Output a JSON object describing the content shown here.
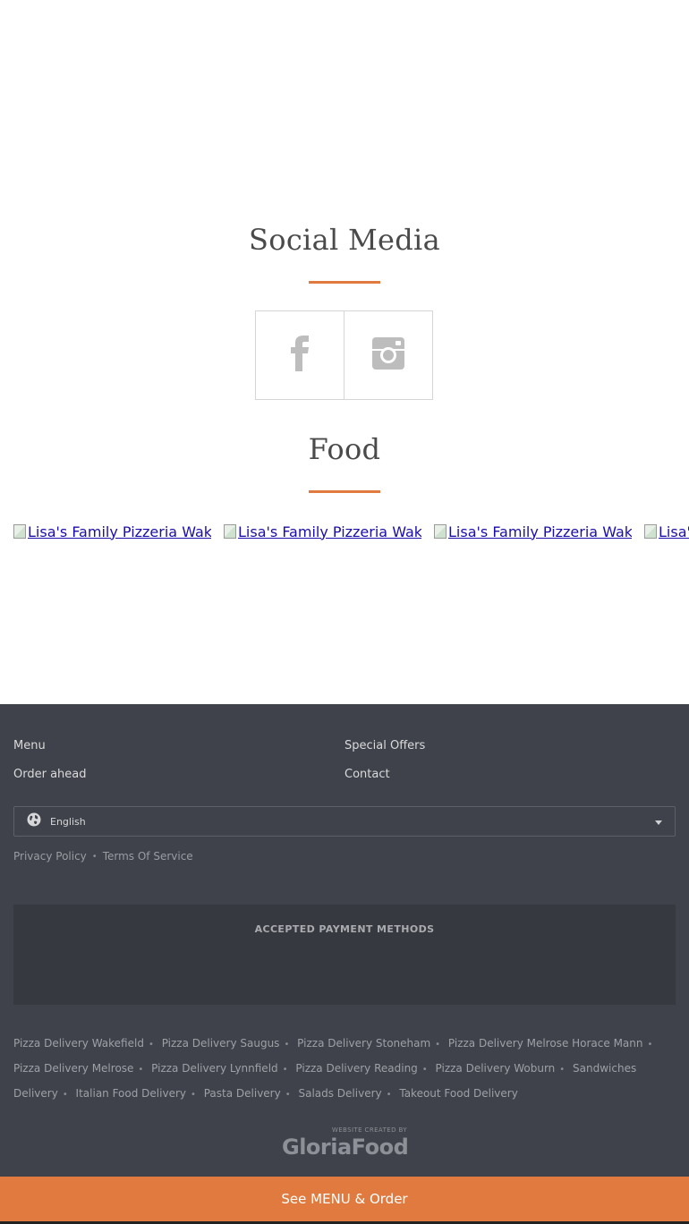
{
  "social": {
    "title": "Social Media",
    "links": [
      {
        "icon": "facebook-icon"
      },
      {
        "icon": "instagram-icon"
      }
    ]
  },
  "food": {
    "title": "Food",
    "images": [
      {
        "alt": "Lisa's Family Pizzeria Wakefield"
      },
      {
        "alt": "Lisa's Family Pizzeria Wakefield"
      },
      {
        "alt": "Lisa's Family Pizzeria Wakefield"
      },
      {
        "alt": "Lisa's Family Pizzeria Wakefield"
      }
    ]
  },
  "footer": {
    "nav": {
      "menu": "Menu",
      "special_offers": "Special Offers",
      "order_ahead": "Order ahead",
      "contact": "Contact"
    },
    "language": {
      "selected": "English"
    },
    "legal": {
      "privacy": "Privacy Policy",
      "terms": "Terms Of Service"
    },
    "payment_title": "ACCEPTED PAYMENT METHODS",
    "seo_links": [
      "Pizza Delivery Wakefield",
      "Pizza Delivery Saugus",
      "Pizza Delivery Stoneham",
      "Pizza Delivery Melrose Horace Mann",
      "Pizza Delivery Melrose",
      "Pizza Delivery Lynnfield",
      "Pizza Delivery Reading",
      "Pizza Delivery Woburn",
      "Sandwiches Delivery",
      "Italian Food Delivery",
      "Pasta Delivery",
      "Salads Delivery",
      "Takeout Food Delivery"
    ],
    "brand": {
      "small": "WEBSITE CREATED BY",
      "name": "GloriaFood"
    }
  },
  "order_button": "See MENU & Order",
  "colors": {
    "accent": "#e07a3f",
    "footer_bg": "#3f424a",
    "payment_bg": "#36393f"
  }
}
